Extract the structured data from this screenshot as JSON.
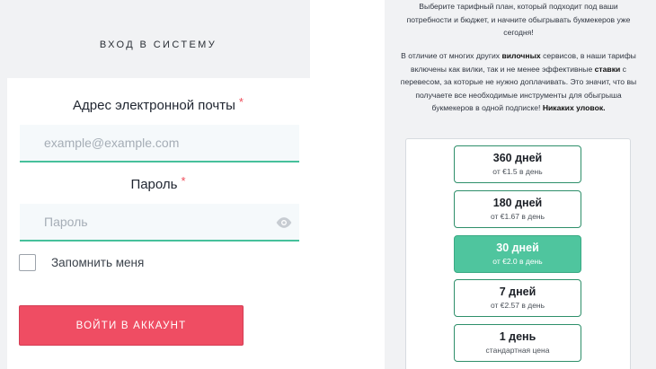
{
  "login": {
    "heading": "ВХОД В СИСТЕМУ",
    "email_label": "Адрес электронной почты",
    "email_placeholder": "example@example.com",
    "password_label": "Пароль",
    "password_placeholder": "Пароль",
    "required_mark": "*",
    "remember_label": "Запомнить меня",
    "submit_label": "ВОЙТИ В АККАУНТ"
  },
  "info": {
    "intro_line1": "Выберите тарифный план, который подходит под ваши",
    "intro_line2": "потребности и бюджет, и начните обыгрывать букмекеров уже",
    "intro_line3": "сегодня!",
    "para_line1_a": "В отличие от многих других ",
    "para_line1_b": "вилочных",
    "para_line1_c": " сервисов, в наши тарифы",
    "para_line2_a": "включены как вилки, так и не менее эффективные ",
    "para_line2_b": "ставки",
    "para_line2_c": " с",
    "para_line3": "перевесом, за которые не нужно доплачивать. Это значит, что вы",
    "para_line4": "получаете все необходимые инструменты для обыгрыша",
    "para_line5_a": "букмекеров в одной подписке! ",
    "para_line5_b": "Никаких уловок."
  },
  "plans": [
    {
      "title": "360 дней",
      "price": "от €1.5 в день",
      "active": false
    },
    {
      "title": "180 дней",
      "price": "от €1.67 в день",
      "active": false
    },
    {
      "title": "30 дней",
      "price": "от €2.0 в день",
      "active": true
    },
    {
      "title": "7 дней",
      "price": "от €2.57 в день",
      "active": false
    },
    {
      "title": "1 день",
      "price": "стандартная цена",
      "active": false
    }
  ],
  "colors": {
    "accent_green": "#4fc59e",
    "button_red": "#ef4d63",
    "input_underline": "#46c09b"
  }
}
